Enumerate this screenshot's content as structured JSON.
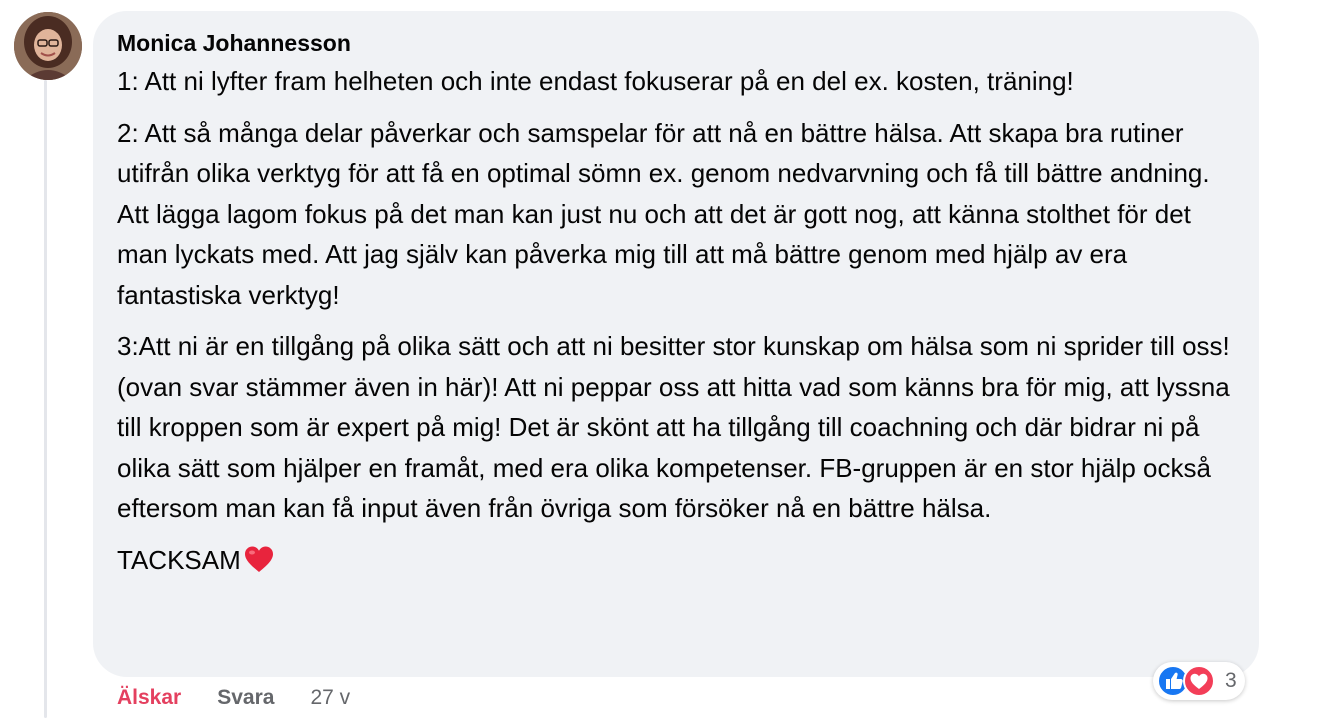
{
  "comment": {
    "author": "Monica Johannesson",
    "paragraphs": [
      "1: Att ni lyfter fram helheten och inte endast fokuserar på en del ex. kosten, träning!",
      "2: Att så många delar påverkar och samspelar för att nå en bättre hälsa. Att skapa bra rutiner utifrån olika verktyg för att få en optimal sömn ex. genom nedvarvning och få till bättre andning. Att lägga lagom fokus på det man kan just nu och att det är gott nog, att känna stolthet för det man lyckats med. Att jag själv kan påverka mig till att må bättre genom med hjälp av era fantastiska verktyg!",
      "3:Att ni är en tillgång på olika sätt och att ni besitter stor kunskap om hälsa som ni sprider till oss! (ovan svar stämmer även in här)! Att ni peppar oss att hitta vad som känns bra för mig, att lyssna till kroppen som är expert på mig! Det är skönt att ha tillgång till coachning och där bidrar ni på olika sätt som hjälper en framåt, med era olika kompetenser. FB-gruppen är en stor hjälp också eftersom man kan få input även från övriga som försöker nå en bättre hälsa."
    ],
    "closing": "TACKSAM",
    "closing_emoji": "red-heart-icon"
  },
  "actions": {
    "love_label": "Älskar",
    "reply_label": "Svara",
    "time": "27 v"
  },
  "reactions": {
    "icons": [
      "like-icon",
      "love-icon"
    ],
    "count": "3"
  },
  "colors": {
    "bubble": "#f0f2f5",
    "love_active": "#e4405f",
    "muted": "#65676b",
    "like_blue": "#1877f2",
    "love_red": "#f33e58"
  }
}
